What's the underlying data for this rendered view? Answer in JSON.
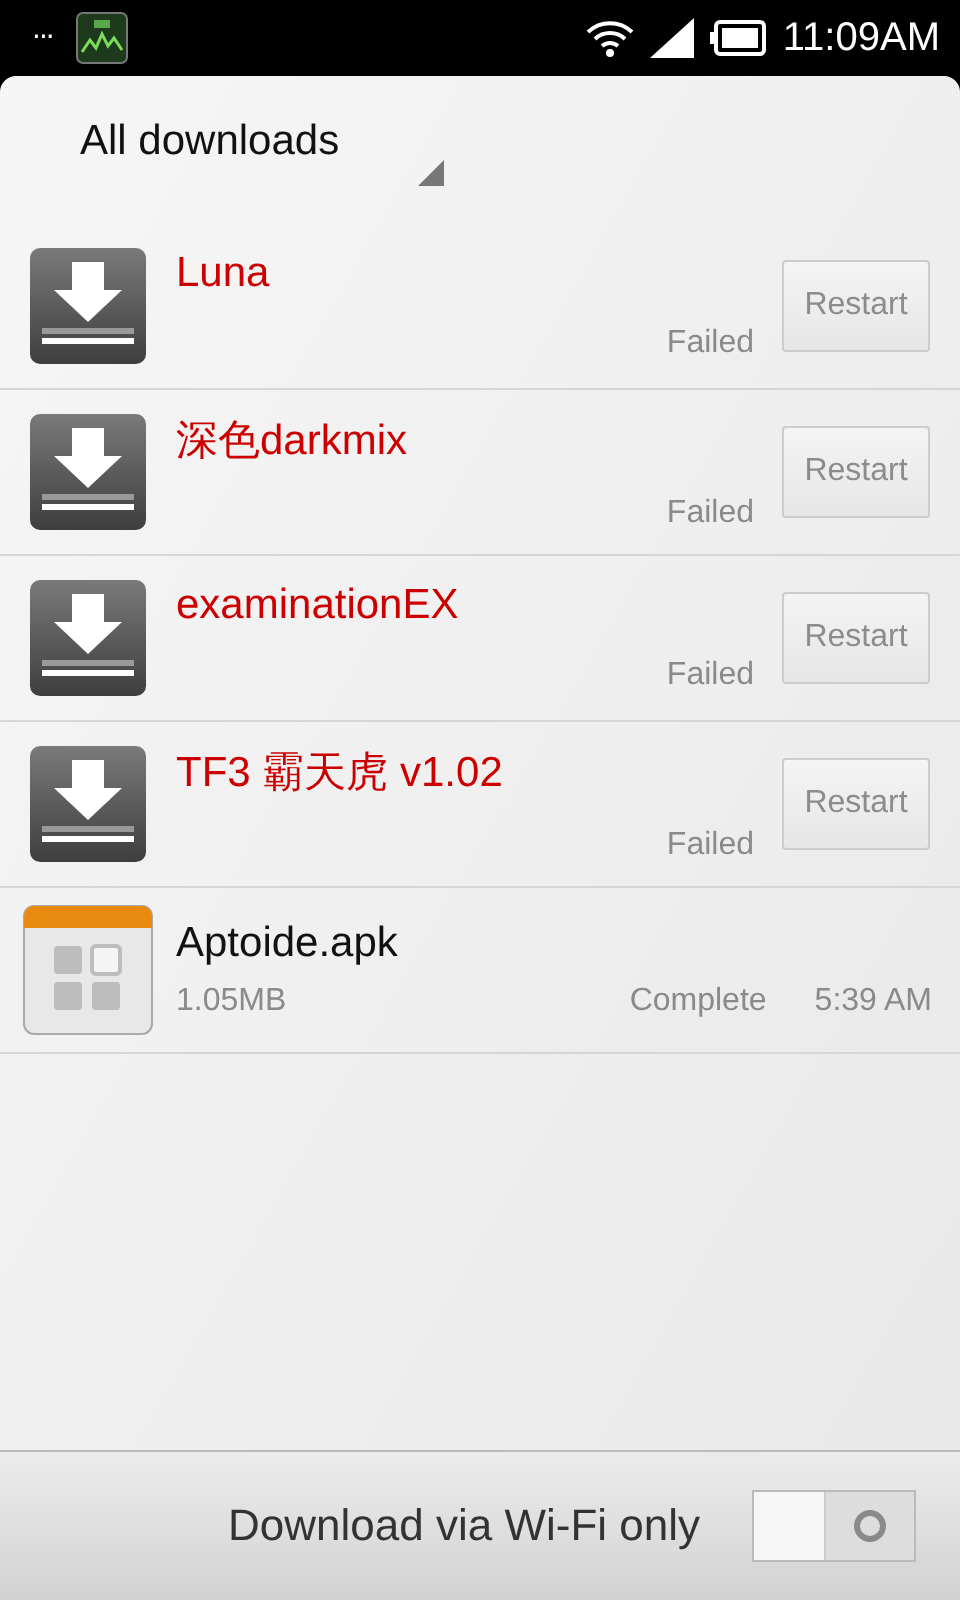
{
  "status_bar": {
    "overflow": "···",
    "time": "11:09AM"
  },
  "header": {
    "title": "All downloads"
  },
  "downloads": [
    {
      "kind": "failed",
      "name": "Luna",
      "status": "Failed",
      "action": "Restart"
    },
    {
      "kind": "failed",
      "name": "深色darkmix",
      "status": "Failed",
      "action": "Restart"
    },
    {
      "kind": "failed",
      "name": "examinationEX",
      "status": "Failed",
      "action": "Restart"
    },
    {
      "kind": "failed",
      "name": "TF3 霸天虎 v1.02",
      "status": "Failed",
      "action": "Restart"
    },
    {
      "kind": "complete",
      "name": "Aptoide.apk",
      "size": "1.05MB",
      "status": "Complete",
      "time": "5:39 AM"
    }
  ],
  "footer": {
    "label": "Download via Wi-Fi only",
    "on": false
  }
}
